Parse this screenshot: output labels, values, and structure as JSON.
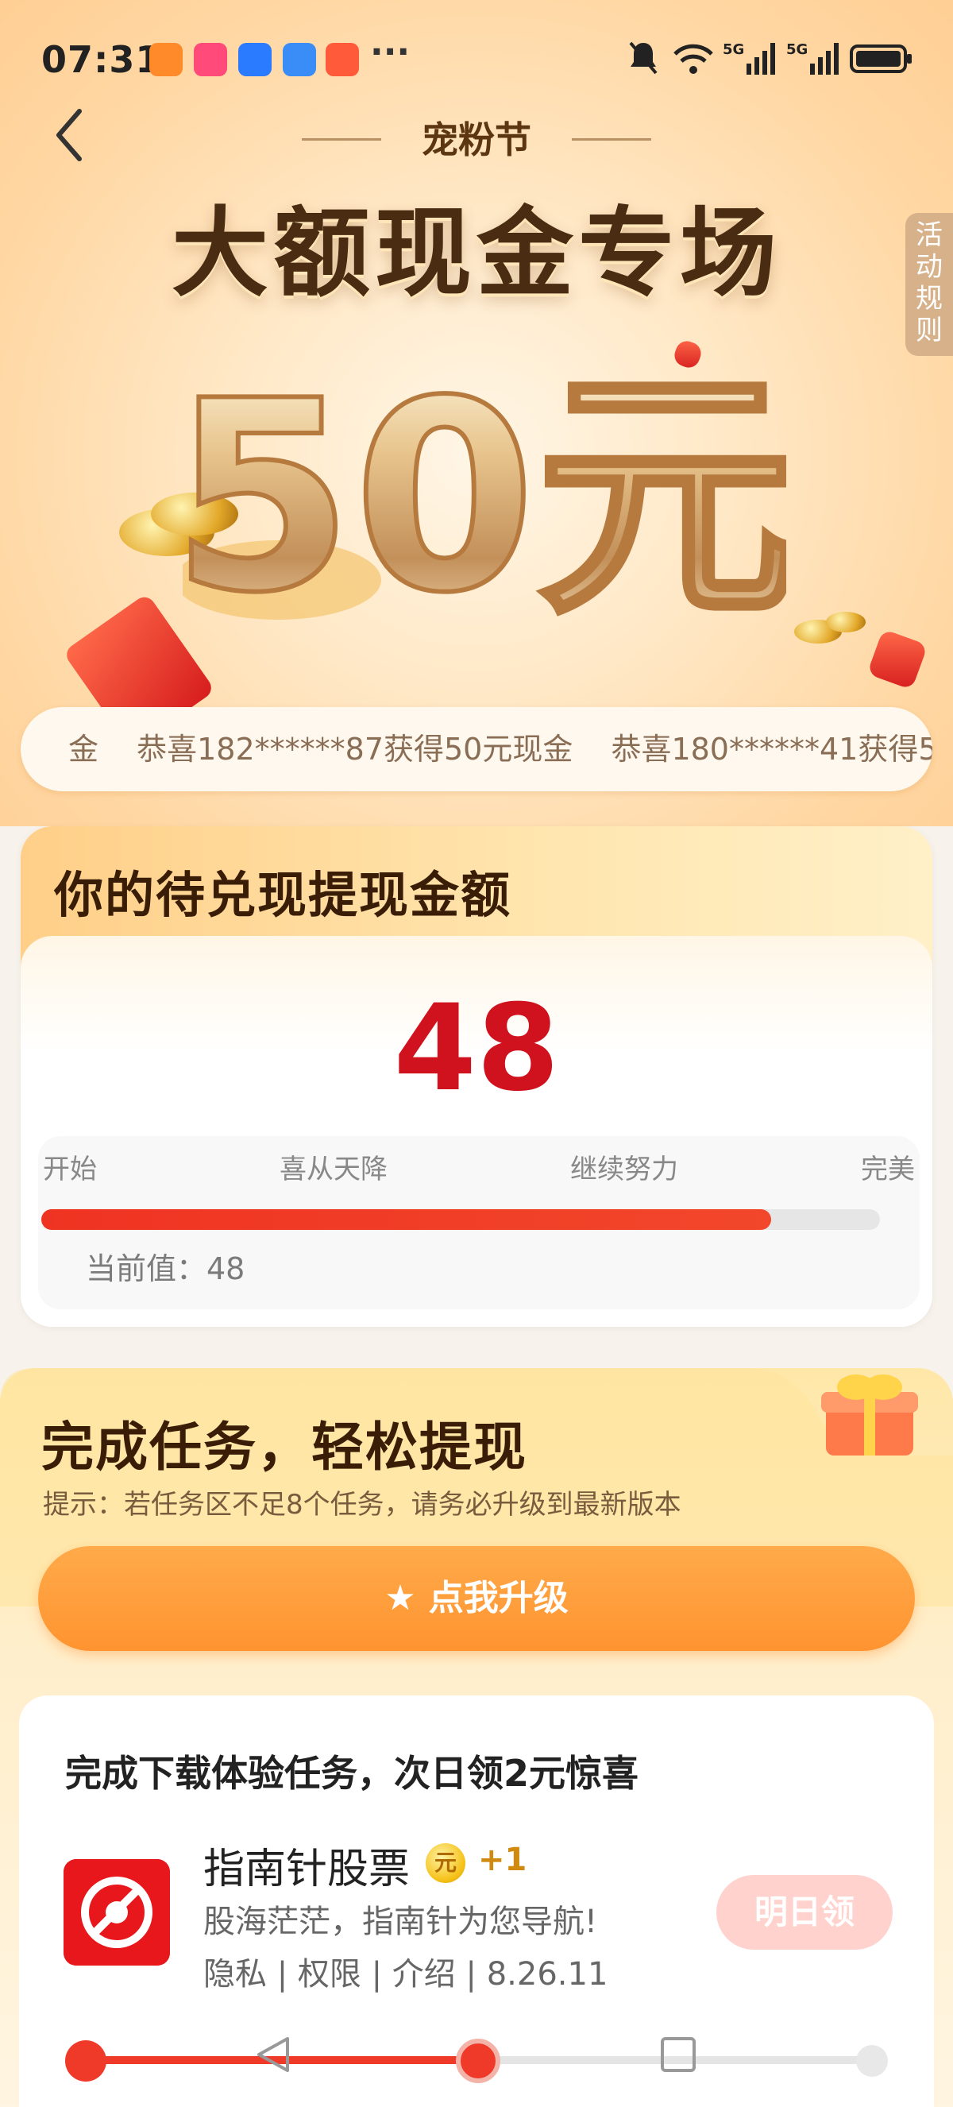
{
  "status_bar": {
    "time": "07:31",
    "more": "···"
  },
  "header": {
    "back_icon": "chevron-left-icon",
    "subtitle": "宠粉节",
    "title": "大额现金专场",
    "rules_tab": "活动规则",
    "prize": "50元"
  },
  "ticker": {
    "items": [
      "金",
      "恭喜182******87获得50元现金",
      "恭喜180******41获得5"
    ]
  },
  "balance_card": {
    "title": "你的待兑现提现金额",
    "amount": "48",
    "milestones": [
      "开始",
      "喜从天降",
      "继续努力",
      "完美"
    ],
    "progress_fraction": 0.87,
    "current_label": "当前值：48"
  },
  "task_section": {
    "title": "完成任务，轻松提现",
    "hint": "提示：若任务区不足8个任务，请务必升级到最新版本",
    "upgrade_button": "点我升级",
    "sub_title": "完成下载体验任务，次日领2元惊喜",
    "app": {
      "name": "指南针股票",
      "badge": "元",
      "reward": "+1",
      "description": "股海茫茫，指南针为您导航!",
      "meta": "隐私 | 权限 | 介绍 | 8.26.11",
      "claim_button": "明日领"
    }
  },
  "colors": {
    "accent_red": "#d0121f",
    "progress_red": "#ef3322",
    "button_orange": "#ff9a36"
  }
}
